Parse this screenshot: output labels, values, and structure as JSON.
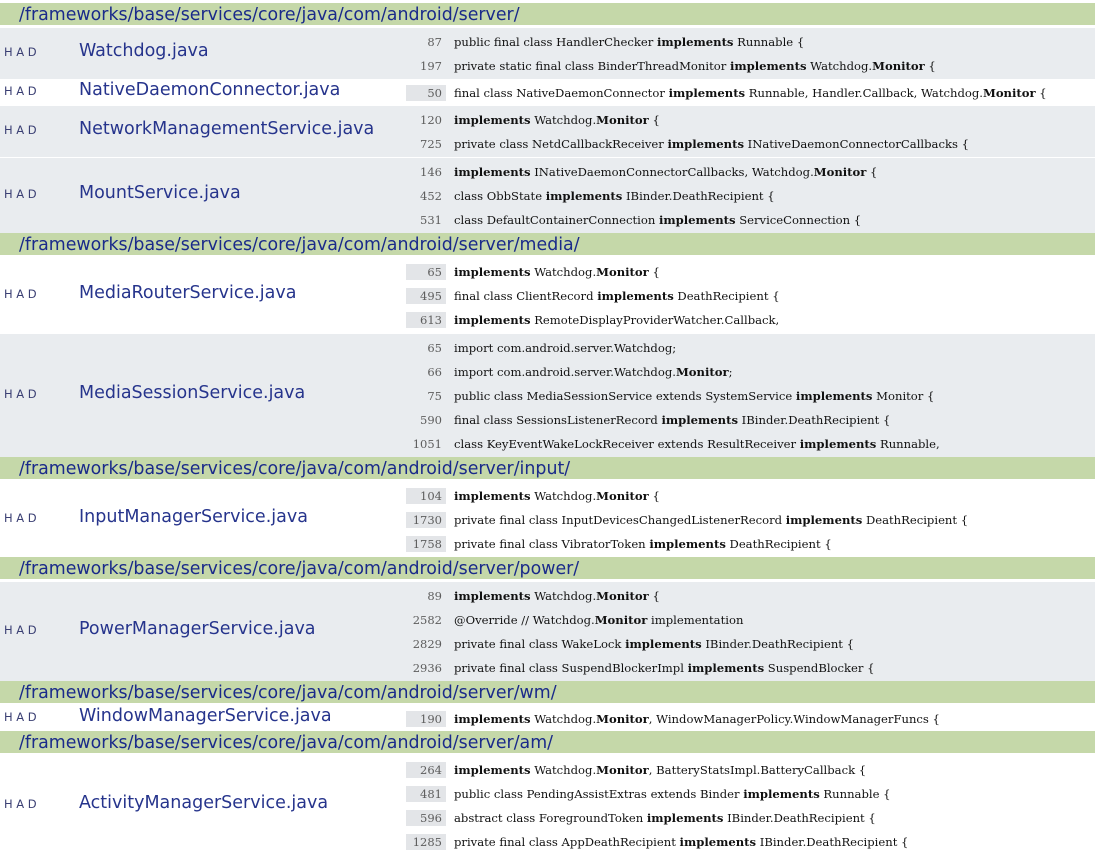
{
  "had_labels": [
    "H",
    "A",
    "D"
  ],
  "groups": [
    {
      "dir": "/frameworks/base/services/core/java/com/android/server/",
      "files": [
        {
          "name": "Watchdog.java",
          "lines": [
            {
              "n": "87",
              "parts": [
                "public final class HandlerChecker ",
                "implements",
                " Runnable {"
              ]
            },
            {
              "n": "197",
              "parts": [
                "private static final class BinderThreadMonitor ",
                "implements",
                " Watchdog.",
                "Monitor",
                " {"
              ]
            }
          ]
        },
        {
          "name": "NativeDaemonConnector.java",
          "lines": [
            {
              "n": "50",
              "parts": [
                "final class NativeDaemonConnector ",
                "implements",
                " Runnable, Handler.Callback, Watchdog.",
                "Monitor",
                " {"
              ]
            }
          ]
        },
        {
          "name": "NetworkManagementService.java",
          "lines": [
            {
              "n": "120",
              "parts": [
                "",
                "implements",
                " Watchdog.",
                "Monitor",
                " {"
              ]
            },
            {
              "n": "725",
              "parts": [
                "private class NetdCallbackReceiver ",
                "implements",
                " INativeDaemonConnectorCallbacks {"
              ]
            }
          ]
        },
        {
          "name": "MountService.java",
          "lines": [
            {
              "n": "146",
              "parts": [
                "",
                "implements",
                " INativeDaemonConnectorCallbacks, Watchdog.",
                "Monitor",
                " {"
              ]
            },
            {
              "n": "452",
              "parts": [
                "class ObbState ",
                "implements",
                " IBinder.DeathRecipient {"
              ]
            },
            {
              "n": "531",
              "parts": [
                "class DefaultContainerConnection ",
                "implements",
                " ServiceConnection {"
              ]
            }
          ]
        }
      ]
    },
    {
      "dir": "/frameworks/base/services/core/java/com/android/server/media/",
      "files": [
        {
          "name": "MediaRouterService.java",
          "lines": [
            {
              "n": "65",
              "parts": [
                "",
                "implements",
                " Watchdog.",
                "Monitor",
                " {"
              ]
            },
            {
              "n": "495",
              "parts": [
                "final class ClientRecord ",
                "implements",
                " DeathRecipient {"
              ]
            },
            {
              "n": "613",
              "parts": [
                "",
                "implements",
                " RemoteDisplayProviderWatcher.Callback,"
              ]
            }
          ]
        },
        {
          "name": "MediaSessionService.java",
          "lines": [
            {
              "n": "65",
              "parts": [
                "import com.android.server.Watchdog;"
              ]
            },
            {
              "n": "66",
              "parts": [
                "import com.android.server.Watchdog.",
                "Monitor",
                ";"
              ]
            },
            {
              "n": "75",
              "parts": [
                "public class MediaSessionService extends SystemService ",
                "implements",
                " Monitor {"
              ]
            },
            {
              "n": "590",
              "parts": [
                "final class SessionsListenerRecord ",
                "implements",
                " IBinder.DeathRecipient {"
              ]
            },
            {
              "n": "1051",
              "parts": [
                "class KeyEventWakeLockReceiver extends ResultReceiver ",
                "implements",
                " Runnable,"
              ]
            }
          ]
        }
      ]
    },
    {
      "dir": "/frameworks/base/services/core/java/com/android/server/input/",
      "files": [
        {
          "name": "InputManagerService.java",
          "lines": [
            {
              "n": "104",
              "parts": [
                "",
                "implements",
                " Watchdog.",
                "Monitor",
                " {"
              ]
            },
            {
              "n": "1730",
              "parts": [
                "private final class InputDevicesChangedListenerRecord ",
                "implements",
                " DeathRecipient {"
              ]
            },
            {
              "n": "1758",
              "parts": [
                "private final class VibratorToken ",
                "implements",
                " DeathRecipient {"
              ]
            }
          ]
        }
      ]
    },
    {
      "dir": "/frameworks/base/services/core/java/com/android/server/power/",
      "files": [
        {
          "name": "PowerManagerService.java",
          "lines": [
            {
              "n": "89",
              "parts": [
                "",
                "implements",
                " Watchdog.",
                "Monitor",
                " {"
              ]
            },
            {
              "n": "2582",
              "parts": [
                "@Override // Watchdog.",
                "Monitor",
                " implementation"
              ]
            },
            {
              "n": "2829",
              "parts": [
                "private final class WakeLock ",
                "implements",
                " IBinder.DeathRecipient {"
              ]
            },
            {
              "n": "2936",
              "parts": [
                "private final class SuspendBlockerImpl ",
                "implements",
                " SuspendBlocker {"
              ]
            }
          ]
        }
      ]
    },
    {
      "dir": "/frameworks/base/services/core/java/com/android/server/wm/",
      "files": [
        {
          "name": "WindowManagerService.java",
          "lines": [
            {
              "n": "190",
              "parts": [
                "",
                "implements",
                " Watchdog.",
                "Monitor",
                ", WindowManagerPolicy.WindowManagerFuncs {"
              ]
            }
          ]
        }
      ]
    },
    {
      "dir": "/frameworks/base/services/core/java/com/android/server/am/",
      "files": [
        {
          "name": "ActivityManagerService.java",
          "lines": [
            {
              "n": "264",
              "parts": [
                "",
                "implements",
                " Watchdog.",
                "Monitor",
                ", BatteryStatsImpl.BatteryCallback {"
              ]
            },
            {
              "n": "481",
              "parts": [
                "public class PendingAssistExtras extends Binder ",
                "implements",
                " Runnable {"
              ]
            },
            {
              "n": "596",
              "parts": [
                "abstract class ForegroundToken ",
                "implements",
                " IBinder.DeathRecipient {"
              ]
            },
            {
              "n": "1285",
              "parts": [
                "private final class AppDeathRecipient ",
                "implements",
                " IBinder.DeathRecipient {"
              ]
            }
          ]
        }
      ]
    }
  ]
}
